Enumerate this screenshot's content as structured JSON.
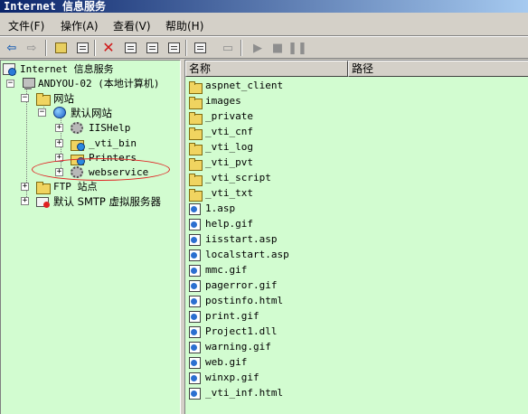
{
  "window": {
    "title": "Internet 信息服务"
  },
  "menu": [
    {
      "label": "文件(F)"
    },
    {
      "label": "操作(A)"
    },
    {
      "label": "查看(V)"
    },
    {
      "label": "帮助(H)"
    }
  ],
  "toolbar": {
    "icons": [
      "back-arrow-icon",
      "forward-arrow-icon",
      "up-folder-icon",
      "show-hide-tree-icon",
      "delete-icon",
      "properties-icon",
      "refresh-icon",
      "export-list-icon",
      "help-icon",
      "computer-icon",
      "start-icon",
      "stop-icon",
      "pause-icon"
    ]
  },
  "tree": {
    "root": "Internet 信息服务",
    "computer": "ANDYOU-02 (本地计算机)",
    "websites": "网站",
    "default_site": "默认网站",
    "children": [
      "IISHelp",
      "_vti_bin",
      "Printers",
      "webservice"
    ],
    "ftp": "FTP 站点",
    "smtp": "默认 SMTP 虚拟服务器"
  },
  "list": {
    "columns": [
      "名称",
      "路径"
    ],
    "items": [
      {
        "name": "aspnet_client",
        "type": "folder"
      },
      {
        "name": "images",
        "type": "folder"
      },
      {
        "name": "_private",
        "type": "folder"
      },
      {
        "name": "_vti_cnf",
        "type": "folder"
      },
      {
        "name": "_vti_log",
        "type": "folder"
      },
      {
        "name": "_vti_pvt",
        "type": "folder"
      },
      {
        "name": "_vti_script",
        "type": "folder"
      },
      {
        "name": "_vti_txt",
        "type": "folder"
      },
      {
        "name": "1.asp",
        "type": "file"
      },
      {
        "name": "help.gif",
        "type": "file"
      },
      {
        "name": "iisstart.asp",
        "type": "file"
      },
      {
        "name": "localstart.asp",
        "type": "file"
      },
      {
        "name": "mmc.gif",
        "type": "file"
      },
      {
        "name": "pagerror.gif",
        "type": "file"
      },
      {
        "name": "postinfo.html",
        "type": "file"
      },
      {
        "name": "print.gif",
        "type": "file"
      },
      {
        "name": "Project1.dll",
        "type": "file"
      },
      {
        "name": "warning.gif",
        "type": "file"
      },
      {
        "name": "web.gif",
        "type": "file"
      },
      {
        "name": "winxp.gif",
        "type": "file"
      },
      {
        "name": "_vti_inf.html",
        "type": "file"
      }
    ]
  },
  "colors": {
    "pane_background": "#d2fcd0",
    "highlight_ellipse": "#e02020"
  }
}
